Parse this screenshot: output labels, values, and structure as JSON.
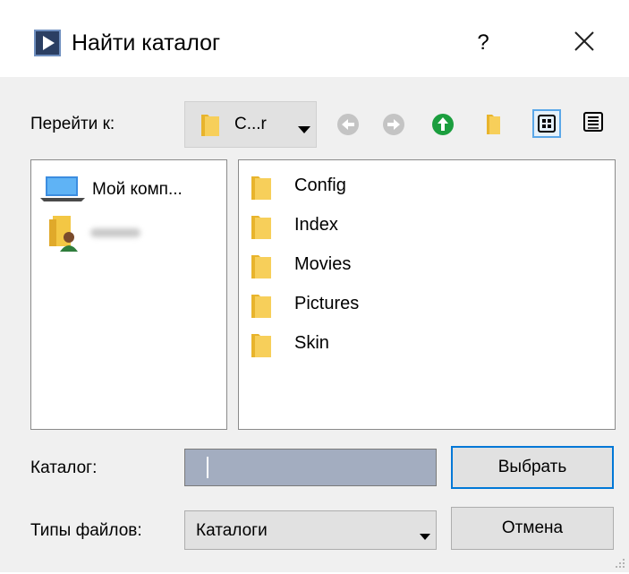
{
  "window": {
    "title": "Найти каталог",
    "help_label": "?",
    "close_icon": "close-icon"
  },
  "toolbar": {
    "goto_label": "Перейти к:",
    "location_value": "C...r",
    "icons": [
      "back-icon",
      "forward-icon",
      "up-icon",
      "new-folder-icon",
      "list-view-icon",
      "details-view-icon"
    ]
  },
  "places": {
    "items": [
      {
        "label": "Мой комп...",
        "icon": "computer-icon"
      },
      {
        "label": "",
        "icon": "user-folder-icon"
      }
    ]
  },
  "files": {
    "items": [
      "Config",
      "Index",
      "Movies",
      "Pictures",
      "Skin"
    ]
  },
  "form": {
    "catalog_label": "Каталог:",
    "catalog_value": "",
    "filetype_label": "Типы файлов:",
    "filetype_value": "Каталоги"
  },
  "buttons": {
    "select": "Выбрать",
    "cancel": "Отмена"
  },
  "colors": {
    "accent": "#0078d7",
    "folder": "#f5c342",
    "nav_green": "#1b9e3e",
    "input_fill": "#a3adc0"
  }
}
